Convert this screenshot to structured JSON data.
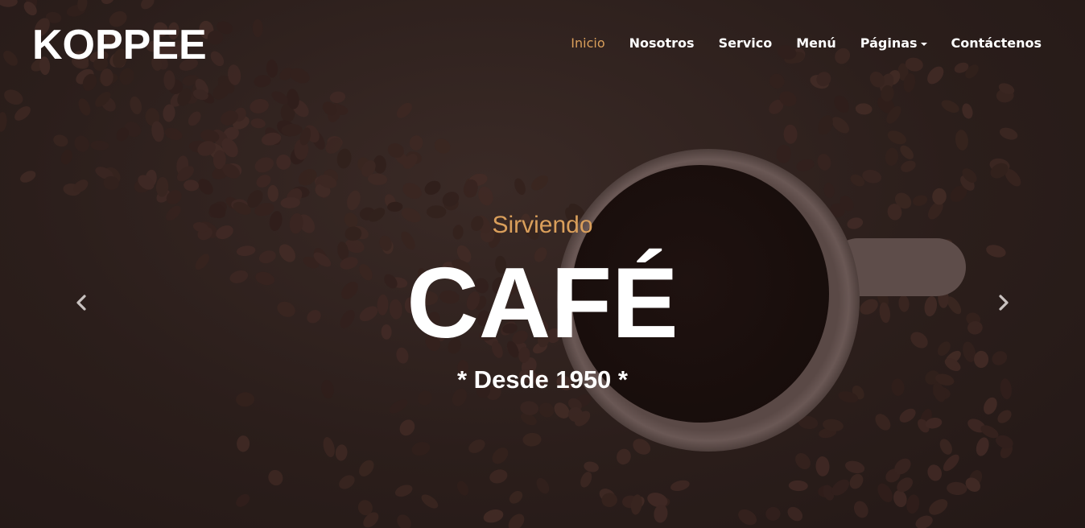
{
  "brand": {
    "name": "KOPPEE"
  },
  "nav": {
    "items": [
      {
        "label": "Inicio",
        "active": true
      },
      {
        "label": "Nosotros"
      },
      {
        "label": "Servico"
      },
      {
        "label": "Menú"
      },
      {
        "label": "Páginas",
        "dropdown": true
      },
      {
        "label": "Contáctenos"
      }
    ]
  },
  "hero": {
    "kicker": "Sirviendo",
    "headline": "CAFÉ",
    "tagline": "* Desde 1950 *"
  },
  "carousel": {
    "prev_icon": "chevron-left-icon",
    "next_icon": "chevron-right-icon"
  },
  "colors": {
    "accent": "#da9f5b",
    "text": "#ffffff",
    "background": "#2a1d1b"
  }
}
